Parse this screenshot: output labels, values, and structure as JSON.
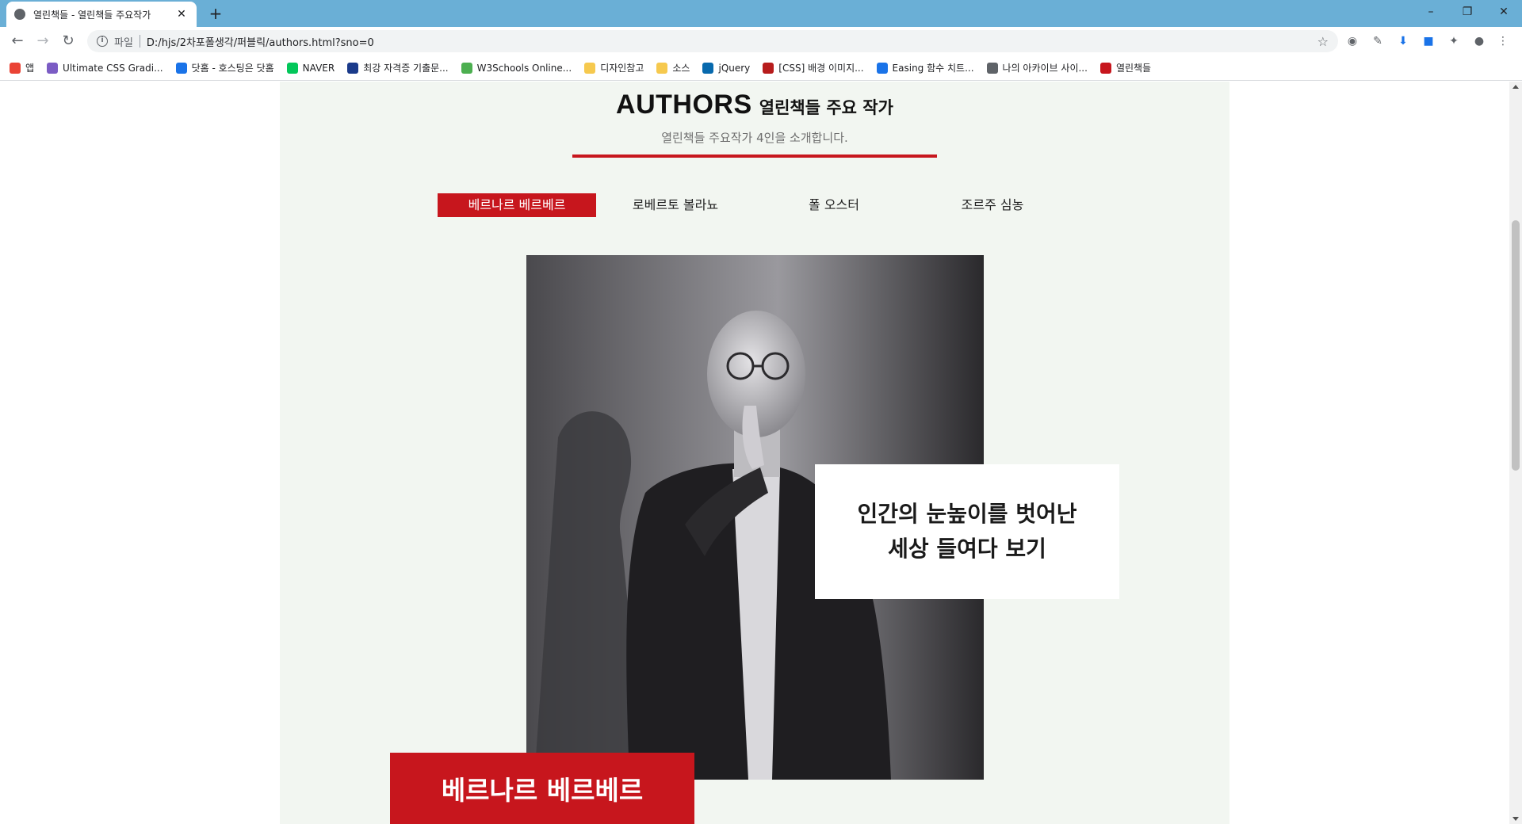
{
  "browser": {
    "tab_title": "열린책들 - 열린책들 주요작가",
    "tab_close": "✕",
    "new_tab": "+",
    "scheme_label": "파일",
    "url": "D:/hjs/2차포폴생각/퍼블릭/authors.html?sno=0",
    "bookmarks": [
      {
        "label": "앱",
        "color": "#ea4335"
      },
      {
        "label": "Ultimate CSS Gradi...",
        "color": "#7b5cc4"
      },
      {
        "label": "닷홈 - 호스팅은 닷홈",
        "color": "#1a73e8"
      },
      {
        "label": "NAVER",
        "color": "#03c75a"
      },
      {
        "label": "최강 자격증 기출문...",
        "color": "#1a3a8a"
      },
      {
        "label": "W3Schools Online...",
        "color": "#4caf50"
      },
      {
        "label": "디자인참고",
        "color": "#f6c94e"
      },
      {
        "label": "소스",
        "color": "#f6c94e"
      },
      {
        "label": "jQuery",
        "color": "#0769ad"
      },
      {
        "label": "[CSS] 배경 이미지...",
        "color": "#b71c1c"
      },
      {
        "label": "Easing 함수 치트...",
        "color": "#1a73e8"
      },
      {
        "label": "나의 아카이브 사이...",
        "color": "#5f6368"
      },
      {
        "label": "열린책들",
        "color": "#c7161d"
      }
    ]
  },
  "page": {
    "heading_main": "AUTHORS",
    "heading_sub": "열린책들 주요 작가",
    "subtitle": "열린책들 주요작가 4인을 소개합니다.",
    "tabs": [
      "베르나르 베르베르",
      "로베르토 볼라뇨",
      "폴 오스터",
      "조르주 심농"
    ],
    "active_tab": 0,
    "quote_line1": "인간의 눈높이를 벗어난",
    "quote_line2": "세상 들여다 보기",
    "author_name": "베르나르 베르베르",
    "accent_color": "#c7161d",
    "section_bg": "#f2f6f1"
  }
}
